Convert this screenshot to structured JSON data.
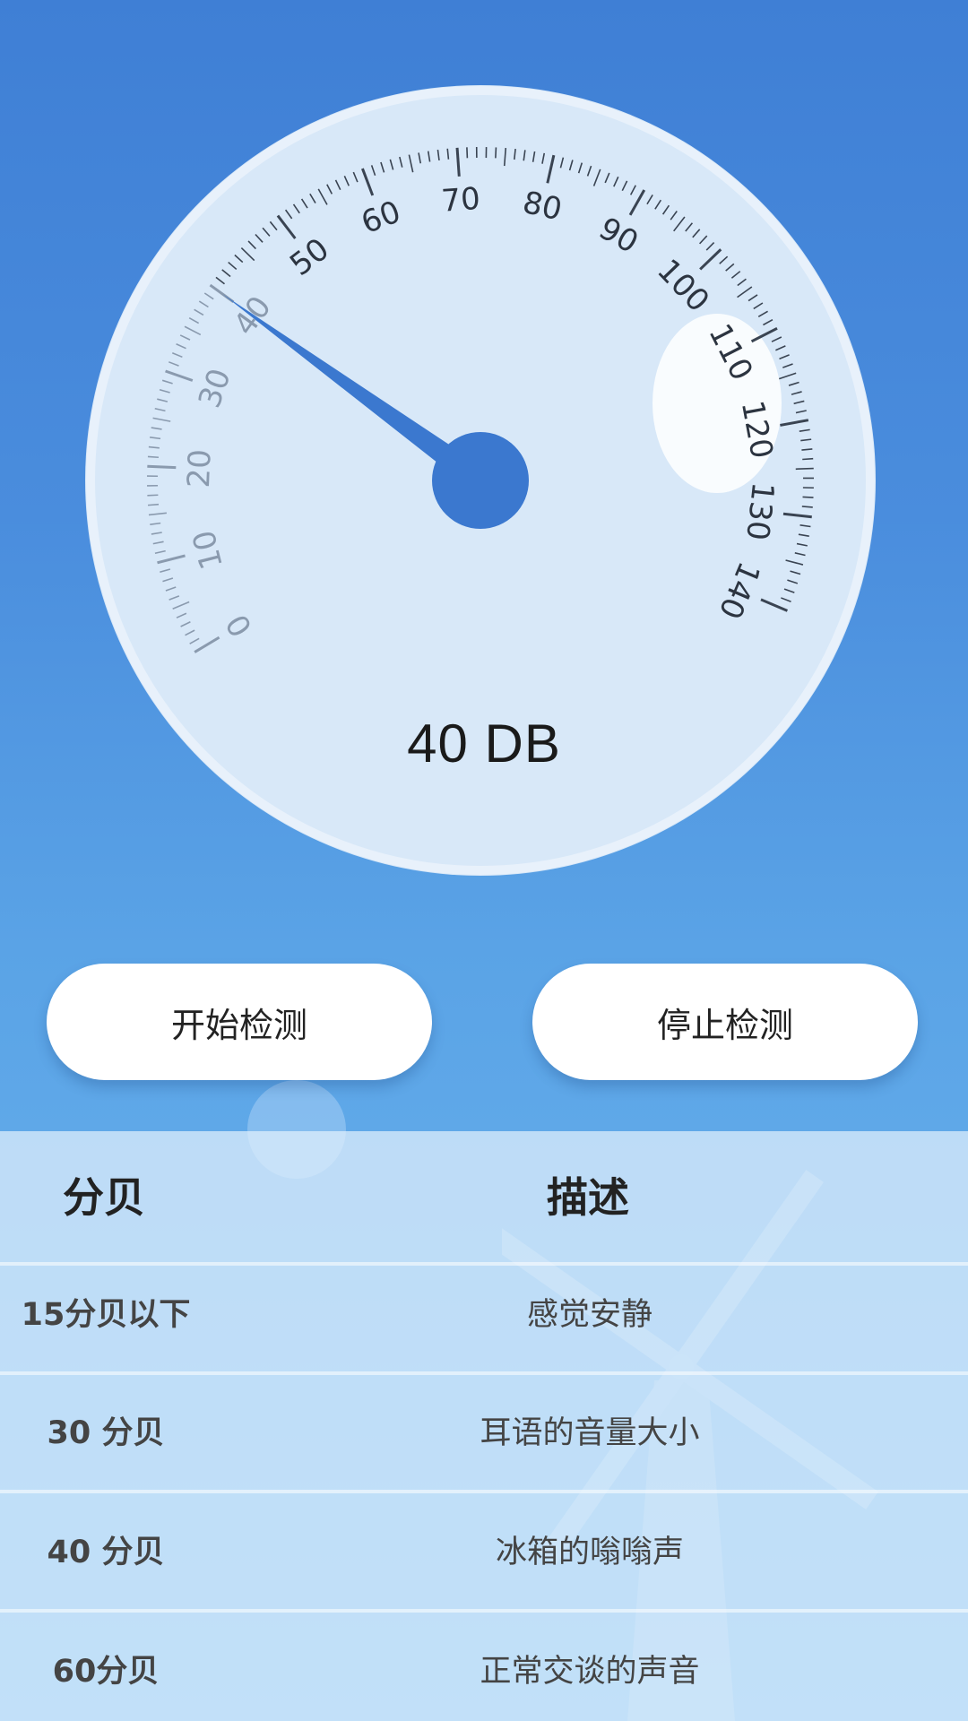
{
  "meter": {
    "value": 40,
    "readout": "40 DB",
    "scale_min": 0,
    "scale_max": 140,
    "tick_labels": [
      "0",
      "10",
      "20",
      "30",
      "40",
      "50",
      "60",
      "70",
      "80",
      "90",
      "100",
      "110",
      "120",
      "130",
      "140"
    ]
  },
  "buttons": {
    "start_label": "开始检测",
    "stop_label": "停止检测"
  },
  "table": {
    "headers": {
      "decibel": "分贝",
      "description": "描述"
    },
    "rows": [
      {
        "decibel": "15分贝以下",
        "description": "感觉安静"
      },
      {
        "decibel": "30 分贝",
        "description": "耳语的音量大小"
      },
      {
        "decibel": "40 分贝",
        "description": "冰箱的嗡嗡声"
      },
      {
        "decibel": "60分贝",
        "description": "正常交谈的声音"
      }
    ]
  },
  "colors": {
    "needle": "#3b78cf",
    "dial": "#d8e8f8",
    "accent": "#3f7fd5"
  }
}
